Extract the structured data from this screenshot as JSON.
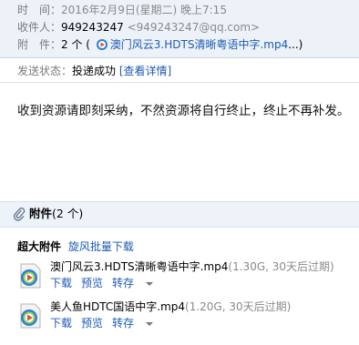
{
  "header": {
    "time_label": "时　间：",
    "time_value": "2016年2月9日(星期二) 晚上7:15",
    "to_label": "收件人：",
    "to_name": "949243247",
    "to_email": "<949243247@qq.com>",
    "att_label": "附　件：",
    "att_count": "2 个 (",
    "att_first": "澳门风云3.HDTS清晰粤语中字.mp4",
    "att_more": "...)"
  },
  "status": {
    "label": "发送状态：",
    "value": "投递成功",
    "link": "[查看详情]"
  },
  "message": {
    "text": "收到资源请即刻采纳，不然资源将自行终止，终止不再补发。"
  },
  "attachments": {
    "title": "附件",
    "count": "(2 个)",
    "big_label": "超大附件",
    "batch_download": "旋风批量下载",
    "files": [
      {
        "name": "澳门风云3.HDTS清晰粤语中字.mp4",
        "meta": "(1.30G, 30天后过期)",
        "download": "下载",
        "preview": "预览",
        "save": "转存"
      },
      {
        "name": "美人鱼HDTC国语中字.mp4",
        "meta": "(1.20G, 30天后过期)",
        "download": "下载",
        "preview": "预览",
        "save": "转存"
      }
    ]
  },
  "colors": {
    "link": "#1d5bb5",
    "header_bg": "#edf2f8",
    "label_gray": "#7a7a7a"
  }
}
